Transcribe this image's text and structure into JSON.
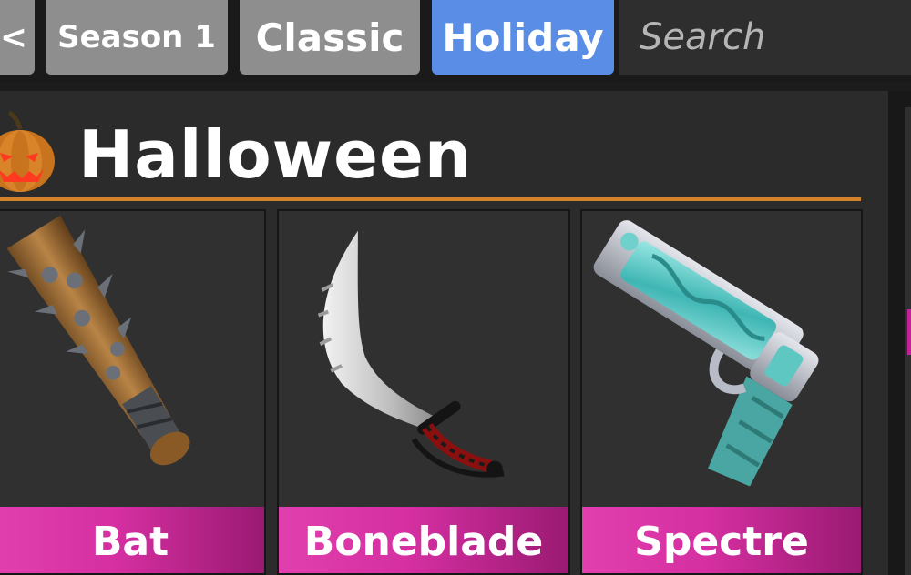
{
  "tabs": {
    "back_label": "<",
    "season_label": "Season 1",
    "classic_label": "Classic",
    "holiday_label": "Holiday"
  },
  "search": {
    "placeholder": "Search",
    "value": ""
  },
  "section": {
    "title": "Halloween",
    "icon": "pumpkin-icon",
    "accent_color": "#d4822a"
  },
  "items": [
    {
      "name": "Bat",
      "icon": "spiked-bat-icon",
      "rarity_color": "#e13fae"
    },
    {
      "name": "Boneblade",
      "icon": "bone-sword-icon",
      "rarity_color": "#e13fae"
    },
    {
      "name": "Spectre",
      "icon": "spectre-revolver-icon",
      "rarity_color": "#e13fae"
    }
  ],
  "colors": {
    "active_tab": "#5a8ee6",
    "inactive_tab": "#8e8e8e"
  }
}
